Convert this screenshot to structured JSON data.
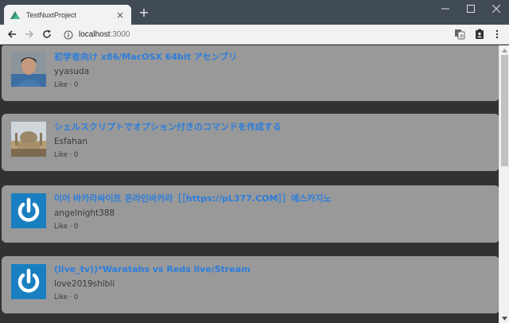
{
  "browser": {
    "tab_title": "TestNuxtProject",
    "url_host": "localhost",
    "url_port": ":3000"
  },
  "posts": [
    {
      "title": "初学者向け x86/MacOSX 64bit アセンブリ",
      "author": "yyasuda",
      "likes": "Like · 0",
      "avatar": "user-photo"
    },
    {
      "title": "シェルスクリプトでオプション付きのコマンドを作成する",
      "author": "Esfahan",
      "likes": "Like · 0",
      "avatar": "mosque-photo"
    },
    {
      "title": "이어 바카라싸이트 온라인바카라［［https://pL377.COM］］예스카지노",
      "author": "angelnight388",
      "likes": "Like · 0",
      "avatar": "power-icon"
    },
    {
      "title": "(live_tv))*Waratahs vs Reds live/Stream",
      "author": "love2019shibli",
      "likes": "Like · 0",
      "avatar": "power-icon"
    }
  ],
  "colors": {
    "page_bg": "#323232",
    "card_bg": "#999999",
    "title_link": "#2d7ddc",
    "avatar_blue": "#1a7fc1"
  }
}
